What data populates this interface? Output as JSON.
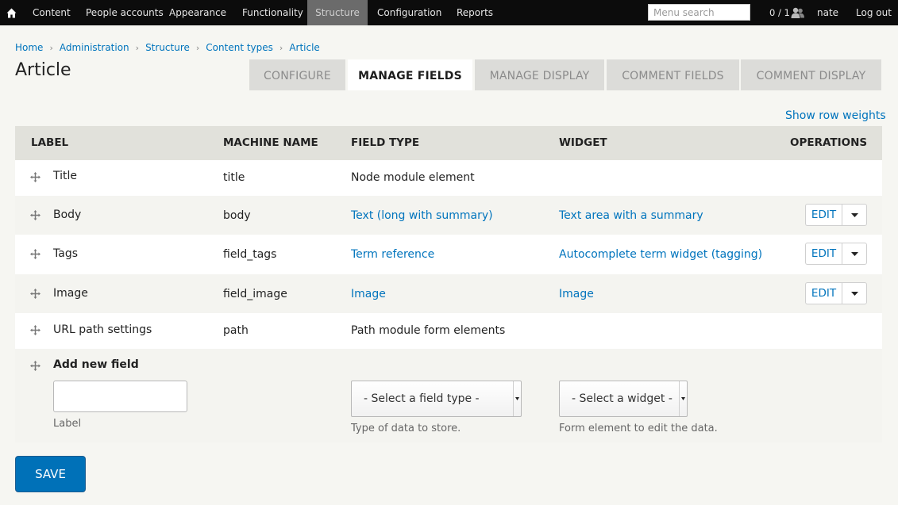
{
  "toolbar": {
    "menu": [
      "Content",
      "People accounts",
      "Appearance",
      "Functionality",
      "Structure",
      "Configuration",
      "Reports"
    ],
    "search_placeholder": "Menu search",
    "users_count": "0 / 1",
    "username": "nate",
    "logout": "Log out"
  },
  "breadcrumb": [
    "Home",
    "Administration",
    "Structure",
    "Content types",
    "Article"
  ],
  "page_title": "Article",
  "tabs": [
    "Configure",
    "Manage fields",
    "Manage display",
    "Comment fields",
    "Comment display"
  ],
  "show_row_weights": "Show row weights",
  "table": {
    "headers": [
      "Label",
      "Machine name",
      "Field type",
      "Widget",
      "Operations"
    ],
    "rows": [
      {
        "label": "Title",
        "machine_name": "title",
        "field_type": "Node module element",
        "widget": ""
      },
      {
        "label": "Body",
        "machine_name": "body",
        "field_type": "Text (long with summary)",
        "widget": "Text area with a summary",
        "edit": "EDIT"
      },
      {
        "label": "Tags",
        "machine_name": "field_tags",
        "field_type": "Term reference",
        "widget": "Autocomplete term widget (tagging)",
        "edit": "EDIT"
      },
      {
        "label": "Image",
        "machine_name": "field_image",
        "field_type": "Image",
        "widget": "Image",
        "edit": "EDIT"
      },
      {
        "label": "URL path settings",
        "machine_name": "path",
        "field_type": "Path module form elements",
        "widget": ""
      }
    ]
  },
  "add_field": {
    "title": "Add new field",
    "label_value": "",
    "label_help": "Label",
    "field_type_select": "- Select a field type -",
    "field_type_help": "Type of data to store.",
    "widget_select": "- Select a widget -",
    "widget_help": "Form element to edit the data."
  },
  "save_label": "Save",
  "colors": {
    "link": "#0074bd",
    "primary_button": "#0071b8",
    "toolbar": "#0c0c0c",
    "active_menu": "#6b6b6b"
  }
}
